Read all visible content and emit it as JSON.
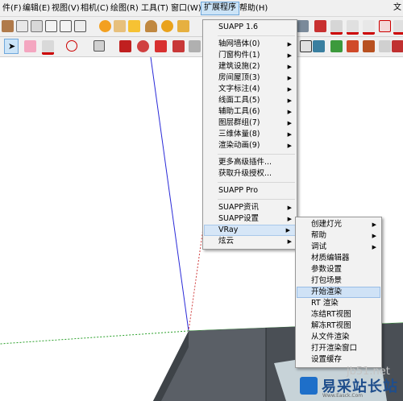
{
  "menubar": {
    "items": [
      "件(F)",
      "编辑(E)",
      "视图(V)",
      "相机(C)",
      "绘图(R)",
      "工具(T)",
      "窗口(W)",
      "扩展程序",
      "帮助(H)"
    ],
    "corner": "文"
  },
  "extensions_menu": {
    "items": [
      {
        "label": "SUAPP 1.6",
        "arrow": ""
      },
      {
        "label": "轴网墙体(0)",
        "arrow": "▶"
      },
      {
        "label": "门窗构件(1)",
        "arrow": "▶"
      },
      {
        "label": "建筑设施(2)",
        "arrow": "▶"
      },
      {
        "label": "房间屋顶(3)",
        "arrow": "▶"
      },
      {
        "label": "文字标注(4)",
        "arrow": "▶"
      },
      {
        "label": "线面工具(5)",
        "arrow": "▶"
      },
      {
        "label": "辅助工具(6)",
        "arrow": "▶"
      },
      {
        "label": "图层群组(7)",
        "arrow": "▶"
      },
      {
        "label": "三维体量(8)",
        "arrow": "▶"
      },
      {
        "label": "渲染动画(9)",
        "arrow": "▶"
      },
      {
        "label": "更多高级插件...",
        "arrow": ""
      },
      {
        "label": "获取升级授权...",
        "arrow": ""
      },
      {
        "label": "SUAPP Pro",
        "arrow": ""
      },
      {
        "label": "SUAPP资讯",
        "arrow": "▶"
      },
      {
        "label": "SUAPP设置",
        "arrow": "▶"
      },
      {
        "label": "VRay",
        "arrow": "▶"
      },
      {
        "label": "炫云",
        "arrow": "▶"
      }
    ]
  },
  "vray_menu": {
    "items": [
      {
        "label": "创建灯光",
        "arrow": "▶"
      },
      {
        "label": "帮助",
        "arrow": "▶"
      },
      {
        "label": "调试",
        "arrow": "▶"
      },
      {
        "label": "材质编辑器",
        "arrow": ""
      },
      {
        "label": "参数设置",
        "arrow": ""
      },
      {
        "label": "打包场景",
        "arrow": ""
      },
      {
        "label": "开始渲染",
        "arrow": ""
      },
      {
        "label": "RT 渲染",
        "arrow": ""
      },
      {
        "label": "冻结RT视图",
        "arrow": ""
      },
      {
        "label": "解冻RT视图",
        "arrow": ""
      },
      {
        "label": "从文件渲染",
        "arrow": ""
      },
      {
        "label": "打开渲染窗口",
        "arrow": ""
      },
      {
        "label": "设置缓存",
        "arrow": ""
      }
    ]
  },
  "watermark": {
    "url": "jb51.net",
    "brand": "易采站长站",
    "sub": "Www.Easck.Com"
  },
  "colors": {
    "menu_highlight": "#cce4f7",
    "axis_blue": "#2a2ad8",
    "axis_green": "#2aa02a",
    "axis_red": "#d04040",
    "floor_dark": "#5a5f66"
  }
}
